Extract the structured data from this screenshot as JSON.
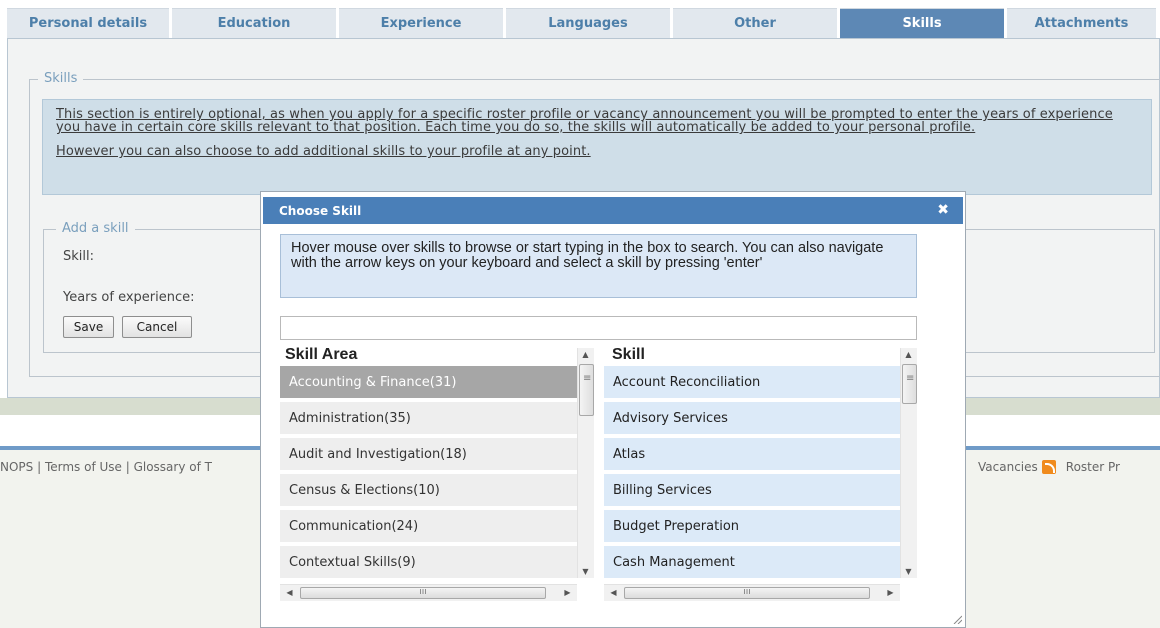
{
  "tabs": [
    {
      "label": "Personal details",
      "active": false
    },
    {
      "label": "Education",
      "active": false
    },
    {
      "label": "Experience",
      "active": false
    },
    {
      "label": "Languages",
      "active": false
    },
    {
      "label": "Other",
      "active": false
    },
    {
      "label": "Skills",
      "active": true
    },
    {
      "label": "Attachments",
      "active": false
    }
  ],
  "skills_section": {
    "legend": "Skills",
    "info_line1": "This section is entirely optional, as when you apply for a specific roster profile or vacancy announcement you will be prompted to enter the years of experience you have in certain core skills relevant to that position. Each time you do so, the skills will automatically be added to your personal profile.",
    "info_line2": "However you can also choose to add additional skills to your profile at any point."
  },
  "add_skill": {
    "legend": "Add a skill",
    "skill_label": "Skill:",
    "years_label": "Years of experience:",
    "save": "Save",
    "cancel": "Cancel"
  },
  "footer": {
    "left_text": "NOPS | Terms of Use | Glossary of T",
    "vacancies": "Vacancies",
    "roster": "Roster Pr"
  },
  "dialog": {
    "title": "Choose Skill",
    "close": "✖",
    "help": "Hover mouse over skills to browse or start typing in the box to search. You can also navigate with the arrow keys on your keyboard and select a skill by pressing 'enter'",
    "search_value": "",
    "area_header": "Skill Area",
    "skill_header": "Skill",
    "areas": [
      "Accounting & Finance(31)",
      "Administration(35)",
      "Audit and Investigation(18)",
      "Census & Elections(10)",
      "Communication(24)",
      "Contextual Skills(9)"
    ],
    "skills": [
      "Account Reconciliation",
      "Advisory Services",
      "Atlas",
      "Billing Services",
      "Budget Preperation",
      "Cash Management"
    ]
  },
  "colors": {
    "tab_active": "#5d88b5",
    "tab_text": "#4d7fa9",
    "dialog_title": "#4a7fb8",
    "skill_item": "#dceaf8",
    "area_selected": "#a6a6a6"
  },
  "icons": {
    "close": "close-icon",
    "rss": "rss-icon"
  }
}
